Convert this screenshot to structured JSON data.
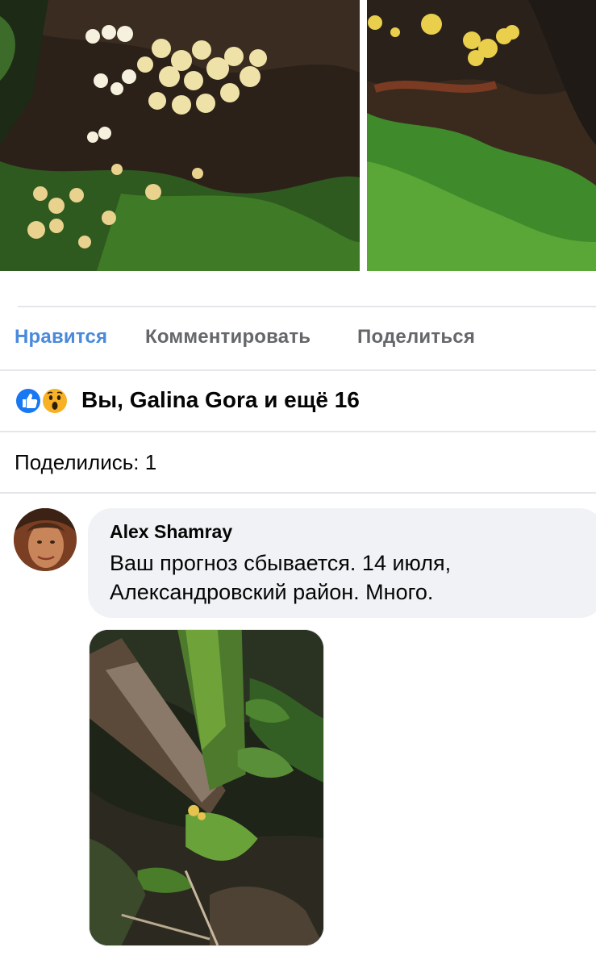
{
  "post": {
    "photos": [
      "mushrooms-on-log",
      "mushrooms-moss-closeup"
    ]
  },
  "actions": {
    "like_label": "Нравится",
    "comment_label": "Комментировать",
    "share_label": "Поделиться"
  },
  "reactions": {
    "icons": [
      "like-icon",
      "wow-icon"
    ],
    "summary": "Вы, Galina Gora и ещё 16"
  },
  "shares": {
    "text": "Поделились: 1"
  },
  "comment": {
    "author": "Alex Shamray",
    "line1": "Ваш прогноз сбывается. 14 июля,",
    "line2": "Александровский район. Много.",
    "attachment": "forest-mushroom-photo"
  },
  "colors": {
    "active_blue": "#4a89dc",
    "action_gray": "#65676b",
    "bubble_bg": "#f0f2f5",
    "divider": "#e4e6eb"
  }
}
